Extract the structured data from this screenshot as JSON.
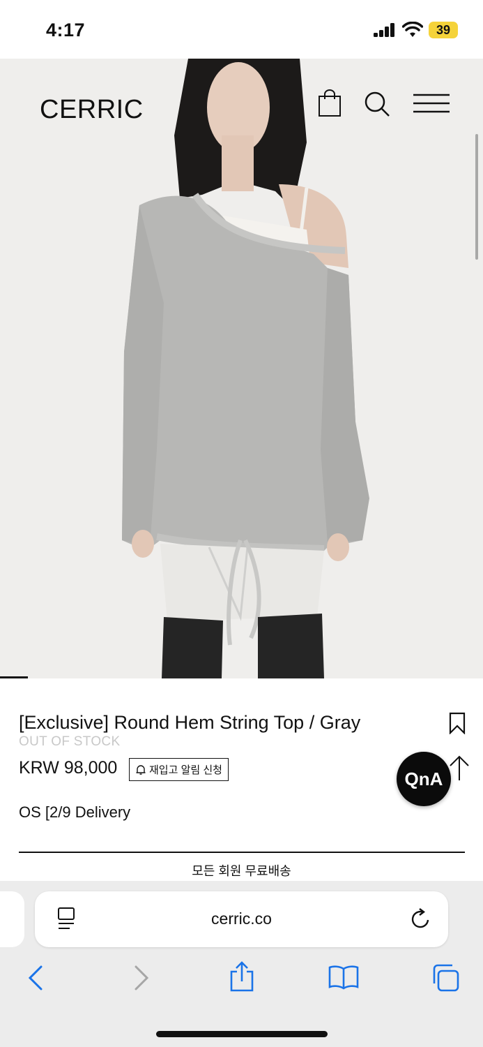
{
  "status": {
    "time": "4:17",
    "battery": "39",
    "icons": [
      "signal-icon",
      "wifi-icon",
      "battery-icon"
    ]
  },
  "header": {
    "logo": "CERRIC",
    "icons": [
      "shopping-bag-icon",
      "search-icon",
      "menu-icon"
    ]
  },
  "product": {
    "title": "[Exclusive] Round Hem String Top / Gray",
    "stock_status": "OUT OF STOCK",
    "price": "KRW 98,000",
    "restock_button": "재입고 알림 신청",
    "delivery": "OS [2/9 Delivery",
    "free_shipping": "모든 회원 무료배송"
  },
  "floating": {
    "qna": "QnA"
  },
  "browser": {
    "url": "cerric.co",
    "icons": [
      "reader-icon",
      "reload-icon",
      "back-icon",
      "forward-icon",
      "share-icon",
      "bookmarks-icon",
      "tabs-icon"
    ]
  },
  "colors": {
    "accent": "#1a73e8",
    "stock_gray": "#c8c8c8",
    "battery": "#f5d33a"
  }
}
